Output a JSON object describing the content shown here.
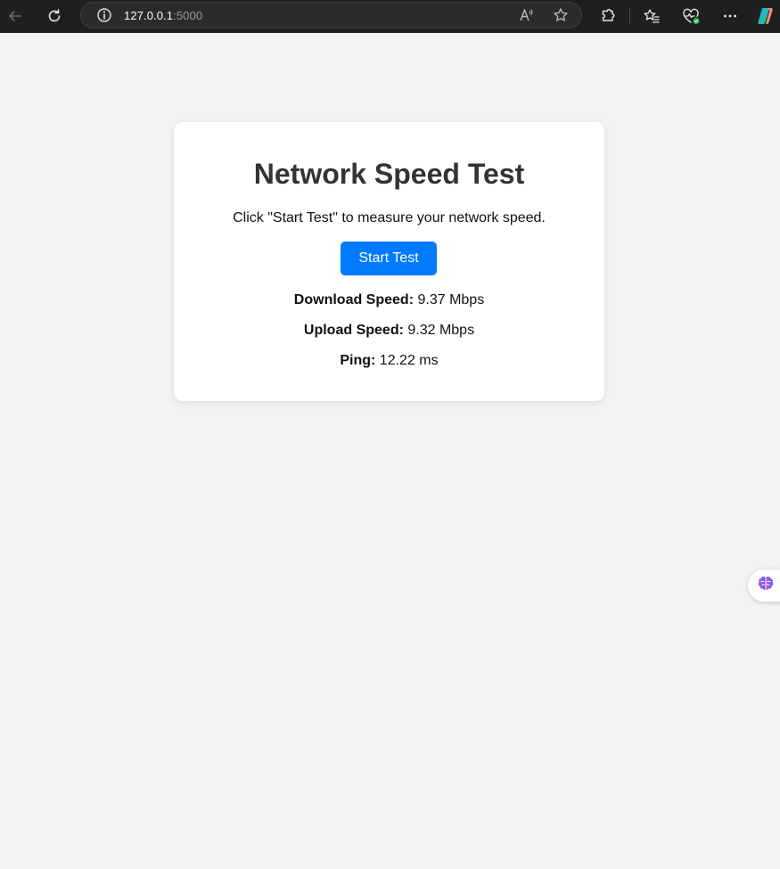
{
  "browser": {
    "url_host": "127.0.0.1",
    "url_port": ":5000",
    "icons": [
      "back-icon",
      "refresh-icon",
      "info-icon",
      "read-aloud-icon",
      "favorite-star-icon",
      "extensions-icon",
      "favorites-icon",
      "browser-essentials-icon",
      "more-icon",
      "copilot-icon"
    ]
  },
  "page": {
    "title": "Network Speed Test",
    "subtitle": "Click \"Start Test\" to measure your network speed.",
    "start_button": "Start Test",
    "download_label": "Download Speed:",
    "download_value": " 9.37 Mbps",
    "upload_label": "Upload Speed:",
    "upload_value": " 9.32 Mbps",
    "ping_label": "Ping:",
    "ping_value": " 12.22 ms"
  },
  "colors": {
    "accent": "#007bff",
    "page_background": "#f3f3f3",
    "card_background": "#ffffff",
    "title": "#333333"
  }
}
